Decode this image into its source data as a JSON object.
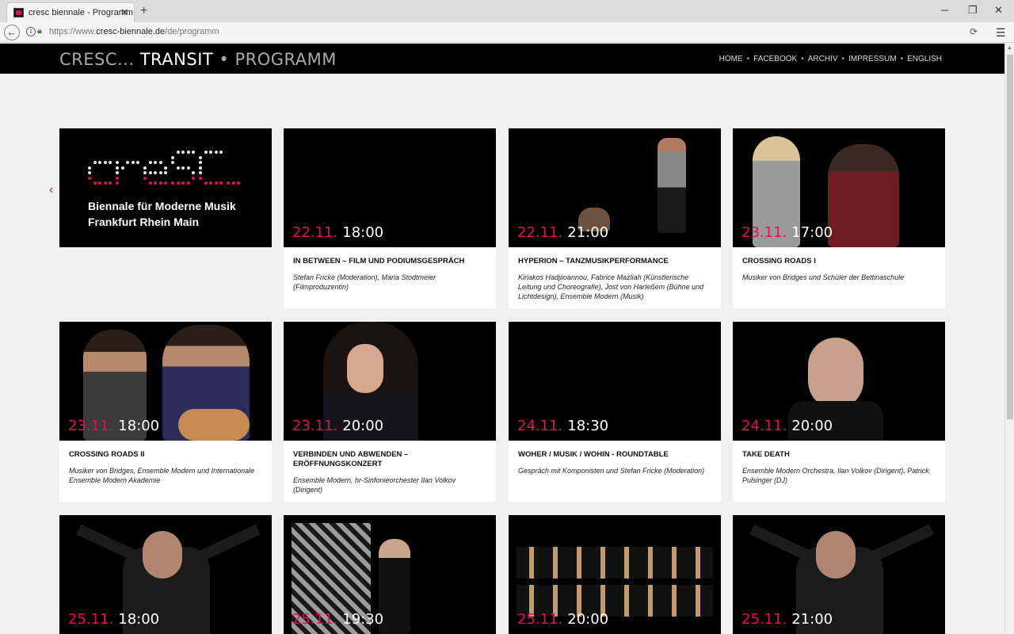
{
  "browser": {
    "tab_title": "cresc biennale - Programm",
    "tab_close": "✕",
    "new_tab": "+",
    "url_prefix": "https://www.",
    "url_host": "cresc-biennale.de",
    "url_path": "/de/programm",
    "win_min": "─",
    "win_max": "❐",
    "win_close": "✕"
  },
  "site": {
    "brand_part1": "CRESC...",
    "brand_part2": "TRANSIT",
    "brand_sep": "•",
    "brand_part3": "PROGRAMM",
    "nav": [
      "HOME",
      "FACEBOOK",
      "ARCHIV",
      "IMPRESSUM",
      "ENGLISH"
    ],
    "nav_sep": "•"
  },
  "logo_card": {
    "tagline1": "Biennale für Moderne Musik",
    "tagline2": "Frankfurt Rhein Main"
  },
  "events": [
    {
      "date": "22.11.",
      "time": "18:00",
      "title": "IN BETWEEN – FILM UND PODIUMSGESPRÄCH",
      "sub": "Stefan Fricke (Moderation), Maria Stodtmeier (Filmproduzentin)"
    },
    {
      "date": "22.11.",
      "time": "21:00",
      "title": "HYPERION – TANZMUSIKPERFORMANCE",
      "sub": "Kiriakos Hadjiioannou, Fabrice Mazliah (Künstlerische Leitung und Choreografie), Jost von Harleßem (Bühne und Lichtdesign), Ensemble Modern (Musik)"
    },
    {
      "date": "23.11.",
      "time": "17:00",
      "title": "CROSSING ROADS I",
      "sub": "Musiker von Bridges und Schüler der Bettinaschule"
    },
    {
      "date": "23.11.",
      "time": "18:00",
      "title": "CROSSING ROADS II",
      "sub": "Musiker von Bridges, Ensemble Modern und Internationale Ensemble Modern Akademie"
    },
    {
      "date": "23.11.",
      "time": "20:00",
      "title": "VERBINDEN UND ABWENDEN – ERÖFFNUNGSKONZERT",
      "sub": "Ensemble Modern, hr-Sinfonieorchester Ilan Volkov (Dirigent)"
    },
    {
      "date": "24.11.",
      "time": "18:30",
      "title": "WOHER / MUSIK / WOHIN - ROUNDTABLE",
      "sub": "Gespräch mit Komponisten und Stefan Fricke (Moderation)"
    },
    {
      "date": "24.11.",
      "time": "20:00",
      "title": "TAKE DEATH",
      "sub": "Ensemble Modern Orchestra, Ilan Volkov (Dirigent), Patrick Pulsinger (DJ)"
    },
    {
      "date": "25.11.",
      "time": "18:00"
    },
    {
      "date": "25.11.",
      "time": "19:30"
    },
    {
      "date": "25.11.",
      "time": "20:00"
    },
    {
      "date": "25.11.",
      "time": "21:00"
    }
  ],
  "colors": {
    "accent": "#e0105a",
    "header_bg": "#000000",
    "page_bg": "#f1f1f1"
  }
}
